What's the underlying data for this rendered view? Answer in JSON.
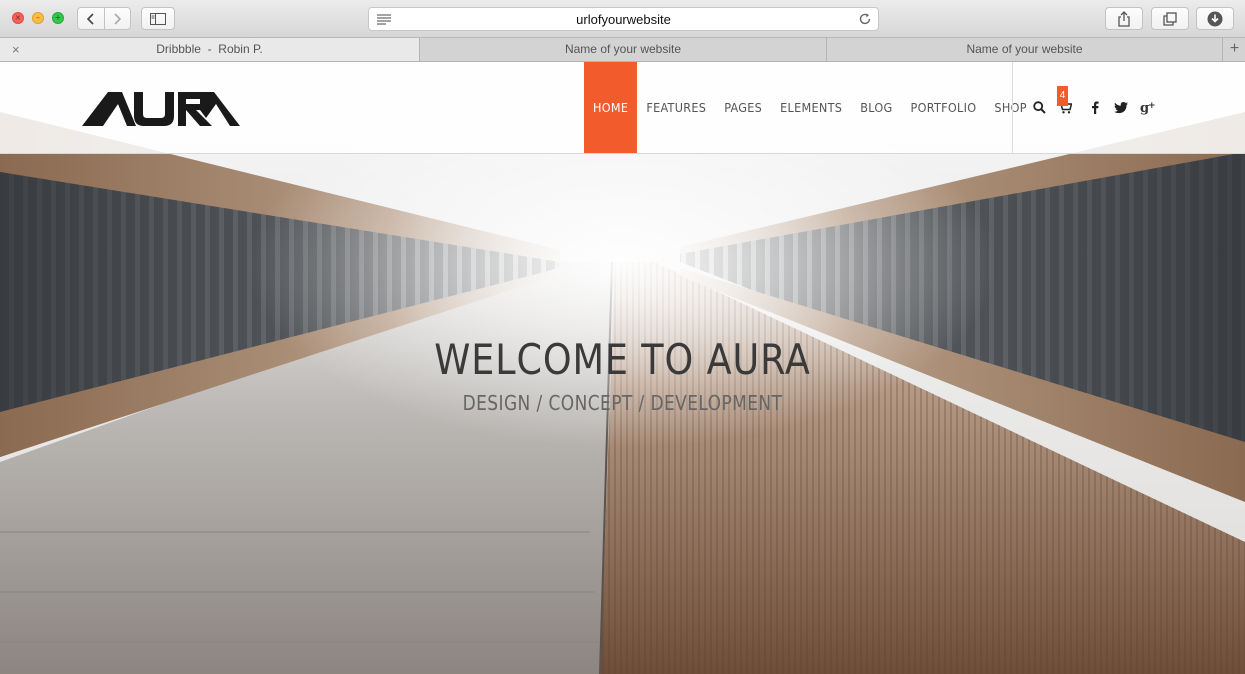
{
  "browser": {
    "url": "urlofyourwebsite",
    "tabs": [
      {
        "label": "Dribbble  -  Robin P."
      },
      {
        "label": "Name of your website"
      },
      {
        "label": "Name of your website"
      }
    ],
    "new_tab_label": "+",
    "close_tab_label": "×",
    "icons": [
      "back-icon",
      "forward-icon",
      "sidebar-icon",
      "reader-icon",
      "reload-icon",
      "share-icon",
      "tabs-overview-icon",
      "download-icon"
    ]
  },
  "site": {
    "logo_text": "AURA",
    "nav": [
      {
        "label": "HOME",
        "active": true
      },
      {
        "label": "FEATURES"
      },
      {
        "label": "PAGES"
      },
      {
        "label": "ELEMENTS"
      },
      {
        "label": "BLOG"
      },
      {
        "label": "PORTFOLIO"
      },
      {
        "label": "SHOP"
      }
    ],
    "cart_count": "4",
    "icons": [
      "search-icon",
      "cart-icon",
      "facebook-icon",
      "twitter-icon",
      "google-plus-icon"
    ],
    "accent_color": "#f25c2c"
  },
  "hero": {
    "title": "WELCOME TO AURA",
    "subtitle": "DESIGN / CONCEPT / DEVELOPMENT"
  }
}
